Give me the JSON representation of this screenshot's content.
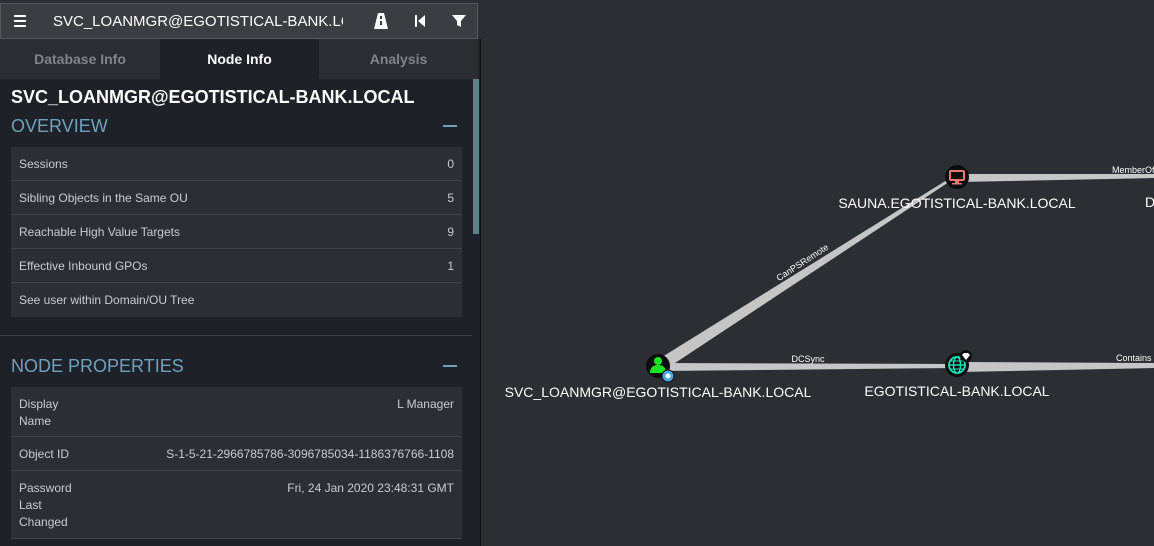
{
  "search": {
    "value": "SVC_LOANMGR@EGOTISTICAL-BANK.LOCAL"
  },
  "toolbar": {
    "menu_icon": "hamburger-icon",
    "path_icon": "road-icon",
    "back_icon": "skip-back-icon",
    "filter_icon": "filter-icon"
  },
  "tabs": [
    {
      "label": "Database Info",
      "active": false
    },
    {
      "label": "Node Info",
      "active": true
    },
    {
      "label": "Analysis",
      "active": false
    }
  ],
  "node": {
    "name": "SVC_LOANMGR@EGOTISTICAL-BANK.LOCAL"
  },
  "overview": {
    "title": "OVERVIEW",
    "rows": [
      {
        "label": "Sessions",
        "value": "0"
      },
      {
        "label": "Sibling Objects in the Same OU",
        "value": "5"
      },
      {
        "label": "Reachable High Value Targets",
        "value": "9"
      },
      {
        "label": "Effective Inbound GPOs",
        "value": "1"
      },
      {
        "label": "See user within Domain/OU Tree",
        "value": ""
      }
    ]
  },
  "properties": {
    "title": "NODE PROPERTIES",
    "rows": [
      {
        "label": "Display\nName",
        "value": "L Manager"
      },
      {
        "label": "Object ID",
        "value": "S-1-5-21-2966785786-3096785034-1186376766-1108"
      },
      {
        "label": "Password\nLast\nChanged",
        "value": "Fri, 24 Jan 2020 23:48:31 GMT"
      }
    ]
  },
  "graph": {
    "nodes": [
      {
        "id": "user",
        "label": "SVC_LOANMGR@EGOTISTICAL-BANK.LOCAL",
        "icon": "user-icon",
        "color": "#17e625"
      },
      {
        "id": "computer",
        "label": "SAUNA.EGOTISTICAL-BANK.LOCAL",
        "icon": "computer-icon",
        "color": "#e67873"
      },
      {
        "id": "domain",
        "label": "EGOTISTICAL-BANK.LOCAL",
        "icon": "globe-icon",
        "color": "#17e6b9"
      },
      {
        "id": "offscreen",
        "label": "D",
        "icon": "",
        "color": ""
      }
    ],
    "edges": [
      {
        "label": "CanPSRemote"
      },
      {
        "label": "DCSync"
      },
      {
        "label": "MemberOf"
      },
      {
        "label": "Contains"
      }
    ]
  },
  "colors": {
    "canvas": "#2b2e33",
    "panel": "#1e2127",
    "accent": "#6fa1bd",
    "edge": "#c6c6c6"
  }
}
